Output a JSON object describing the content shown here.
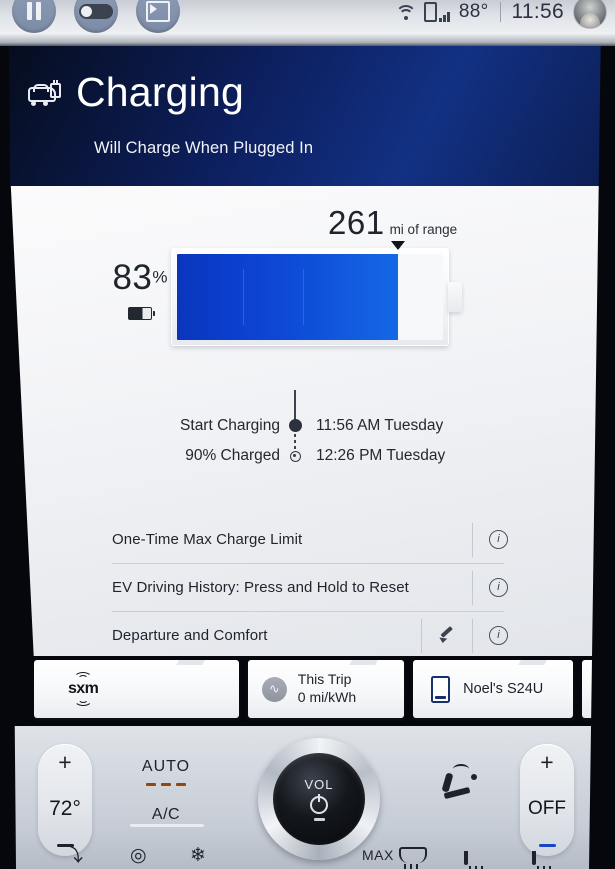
{
  "statusbar": {
    "left_icons": [
      "pause-icon",
      "toggle-switch-icon",
      "cast-screen-icon"
    ],
    "wifi_icon": "wifi-icon",
    "signal_icon": "cellular-signal-icon",
    "temperature": "88°",
    "clock": "11:56",
    "avatar": "user-avatar"
  },
  "header": {
    "icon": "car-charging-plug-icon",
    "title": "Charging",
    "subtitle": "Will Charge When Plugged In",
    "accent_color": "#123183"
  },
  "battery": {
    "range_value": "261",
    "range_unit": "mi of range",
    "percent_value": "83",
    "percent_sign": "%",
    "percent_numeric": 83,
    "battery_icon": "battery-icon",
    "fill_color_start": "#0a36bd",
    "fill_color_end": "#1568e6"
  },
  "schedule": {
    "rows": [
      {
        "label": "Start Charging",
        "time": "11:56 AM Tuesday",
        "marker": "filled-dot"
      },
      {
        "label": "90% Charged",
        "time": "12:26 PM Tuesday",
        "marker": "hollow-dot"
      }
    ]
  },
  "list": {
    "rows": [
      {
        "label": "One-Time Max Charge Limit",
        "has_edit": false,
        "info_icon": "info-icon"
      },
      {
        "label": "EV Driving History:  Press and Hold to Reset",
        "has_edit": false,
        "info_icon": "info-icon"
      },
      {
        "label": "Departure and Comfort",
        "has_edit": true,
        "edit_icon": "pencil-icon",
        "info_icon": "info-icon"
      }
    ]
  },
  "cards": [
    {
      "type": "sxm",
      "logo_text": "sxm",
      "icon": "sxm-radio-icon"
    },
    {
      "type": "trip",
      "icon": "efficiency-icon",
      "title": "This Trip",
      "value": "0 mi/kWh"
    },
    {
      "type": "phone",
      "icon": "phone-icon",
      "name": "Noel's S24U"
    },
    {
      "type": "edge",
      "icon": "blue-circle-logo-icon"
    }
  ],
  "climate": {
    "left": {
      "plus": "+",
      "value": "72°",
      "minus": "minus-icon"
    },
    "right": {
      "plus": "+",
      "value": "OFF",
      "minus": "minus-icon"
    },
    "auto_label": "AUTO",
    "ac_label": "A/C",
    "knob_label": "VOL",
    "knob_icon": "power-icon",
    "seat_icon": "seat-climate-icon",
    "bottom_icons": [
      {
        "name": "foot-vent-icon",
        "glyph": "⤵"
      },
      {
        "name": "heated-steering-wheel-icon",
        "glyph": "◎"
      },
      {
        "name": "fan-icon",
        "glyph": "❄"
      },
      {
        "name": "max-defrost-icon",
        "label": "MAX"
      },
      {
        "name": "rear-defrost-icon",
        "glyph": ""
      },
      {
        "name": "seat-vent-icon",
        "glyph": ""
      }
    ]
  }
}
